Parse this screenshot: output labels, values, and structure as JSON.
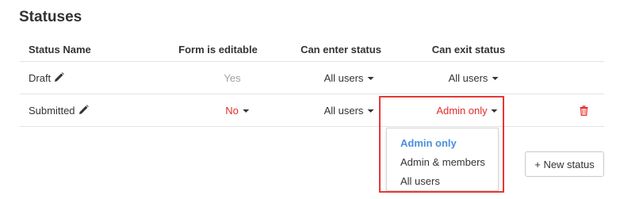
{
  "page": {
    "title": "Statuses"
  },
  "table": {
    "headers": {
      "status_name": "Status Name",
      "form_editable": "Form is editable",
      "can_enter": "Can enter status",
      "can_exit": "Can exit status"
    },
    "rows": [
      {
        "name": "Draft",
        "form_editable": "Yes",
        "can_enter": "All users",
        "can_exit": "All users"
      },
      {
        "name": "Submitted",
        "form_editable": "No",
        "can_enter": "All users",
        "can_exit": "Admin only"
      }
    ]
  },
  "exit_dropdown": {
    "options": [
      "Admin only",
      "Admin & members",
      "All users"
    ],
    "selected": "Admin only"
  },
  "actions": {
    "new_status_label": "+ New status"
  },
  "icons": {
    "edit": "pencil-icon",
    "delete": "trash-icon",
    "dropdown": "caret-down-icon"
  },
  "colors": {
    "text": "#333333",
    "muted": "#a0a0a0",
    "danger": "#e32b2b",
    "highlight": "#e53935",
    "selected_option": "#4a8fe0",
    "divider": "#e3e3e3"
  }
}
